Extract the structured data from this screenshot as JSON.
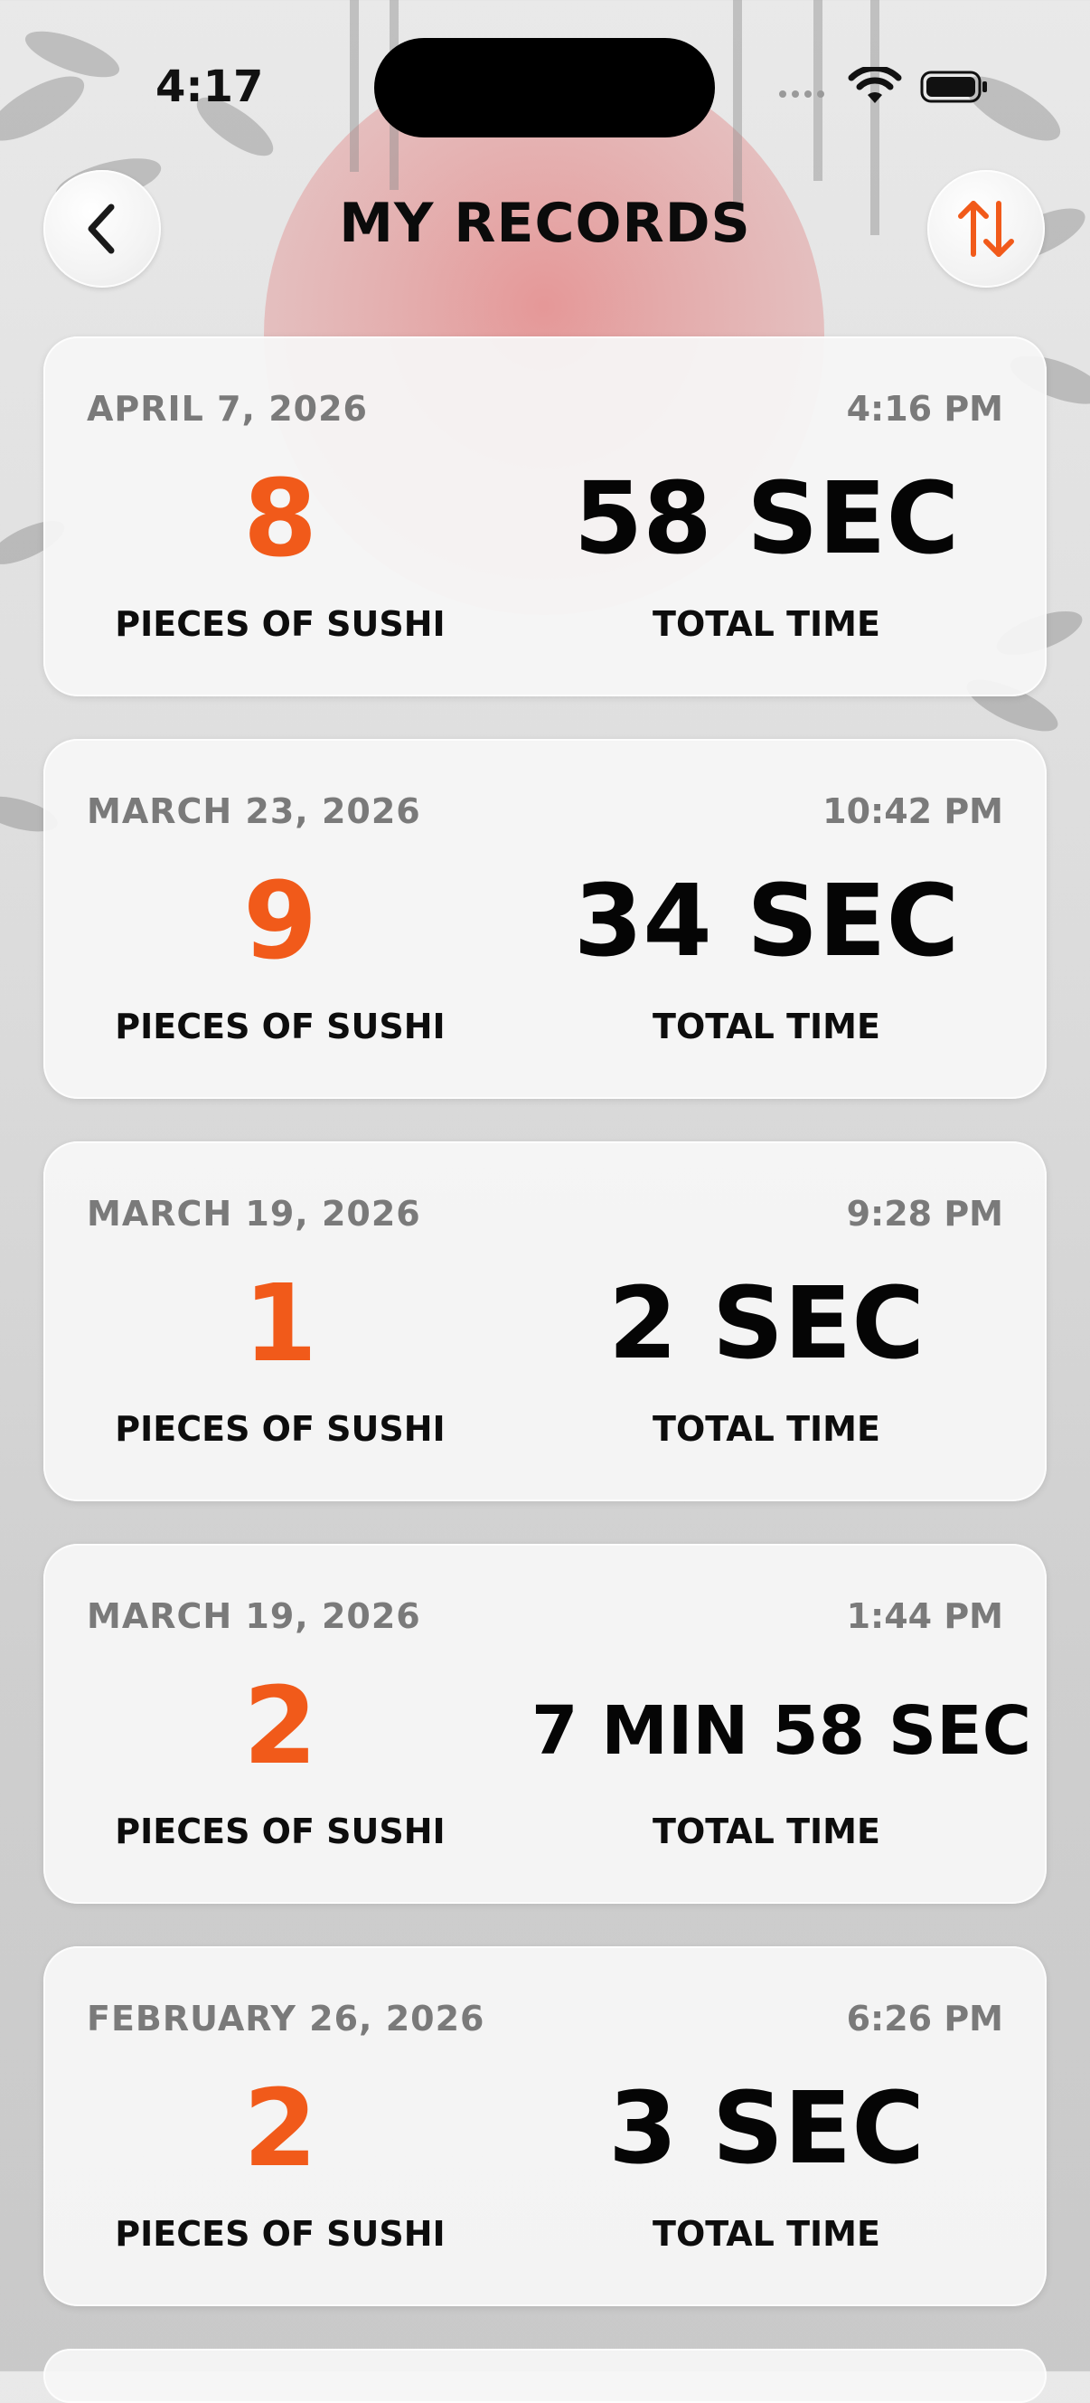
{
  "status_bar": {
    "time": "4:17"
  },
  "header": {
    "title": "MY RECORDS",
    "back_icon": "chevron-left-icon",
    "sort_icon": "sort-arrows-icon"
  },
  "colors": {
    "accent": "#F15A1A",
    "text_primary": "#050505",
    "text_secondary": "#7A7A7A",
    "sun": "#E79A9A"
  },
  "records": [
    {
      "date": "APRIL 7, 2026",
      "time": "4:16 PM",
      "pieces": "8",
      "pieces_label": "PIECES OF SUSHI",
      "total_time": "58 SEC",
      "total_time_label": "TOTAL TIME"
    },
    {
      "date": "MARCH 23, 2026",
      "time": "10:42 PM",
      "pieces": "9",
      "pieces_label": "PIECES OF SUSHI",
      "total_time": "34 SEC",
      "total_time_label": "TOTAL TIME"
    },
    {
      "date": "MARCH 19, 2026",
      "time": "9:28 PM",
      "pieces": "1",
      "pieces_label": "PIECES OF SUSHI",
      "total_time": "2 SEC",
      "total_time_label": "TOTAL TIME"
    },
    {
      "date": "MARCH 19, 2026",
      "time": "1:44 PM",
      "pieces": "2",
      "pieces_label": "PIECES OF SUSHI",
      "total_time": "7 MIN 58 SEC",
      "total_time_label": "TOTAL TIME"
    },
    {
      "date": "FEBRUARY 26, 2026",
      "time": "6:26 PM",
      "pieces": "2",
      "pieces_label": "PIECES OF SUSHI",
      "total_time": "3 SEC",
      "total_time_label": "TOTAL TIME"
    }
  ]
}
